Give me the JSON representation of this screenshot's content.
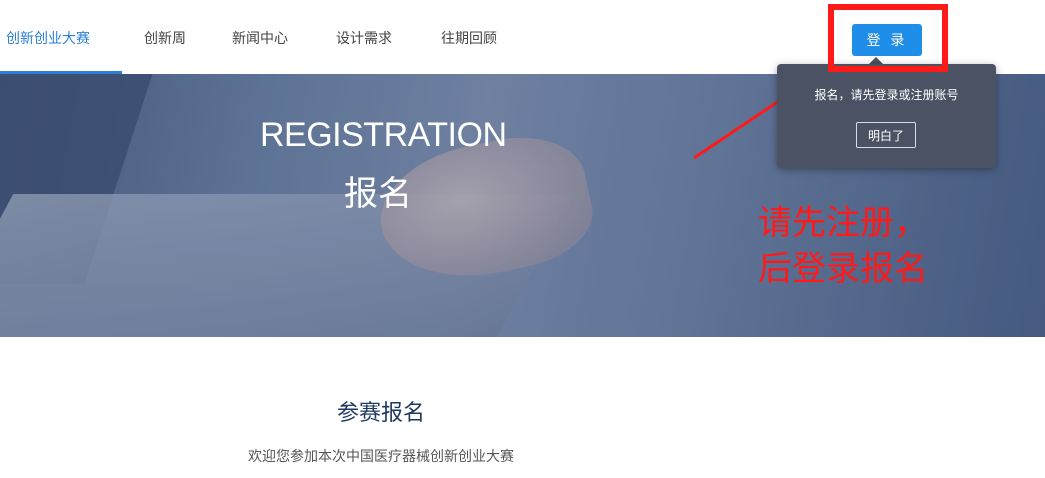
{
  "nav": {
    "items": [
      "创新创业大赛",
      "创新周",
      "新闻中心",
      "设计需求",
      "往期回顾"
    ],
    "active_index": 0,
    "login_label": "登 录"
  },
  "hero": {
    "title_en": "REGISTRATION",
    "title_cn": "报名"
  },
  "tooltip": {
    "text": "报名，请先登录或注册账号",
    "button": "明白了"
  },
  "annotation": {
    "line1": "请先注册，",
    "line2": "后登录报名",
    "color": "#ff1a1a"
  },
  "content": {
    "title": "参赛报名",
    "description": "欢迎您参加本次中国医疗器械创新创业大赛"
  },
  "colors": {
    "accent": "#2b7fd6",
    "button": "#1e8ee8",
    "tooltip_bg": "#4b5263"
  }
}
